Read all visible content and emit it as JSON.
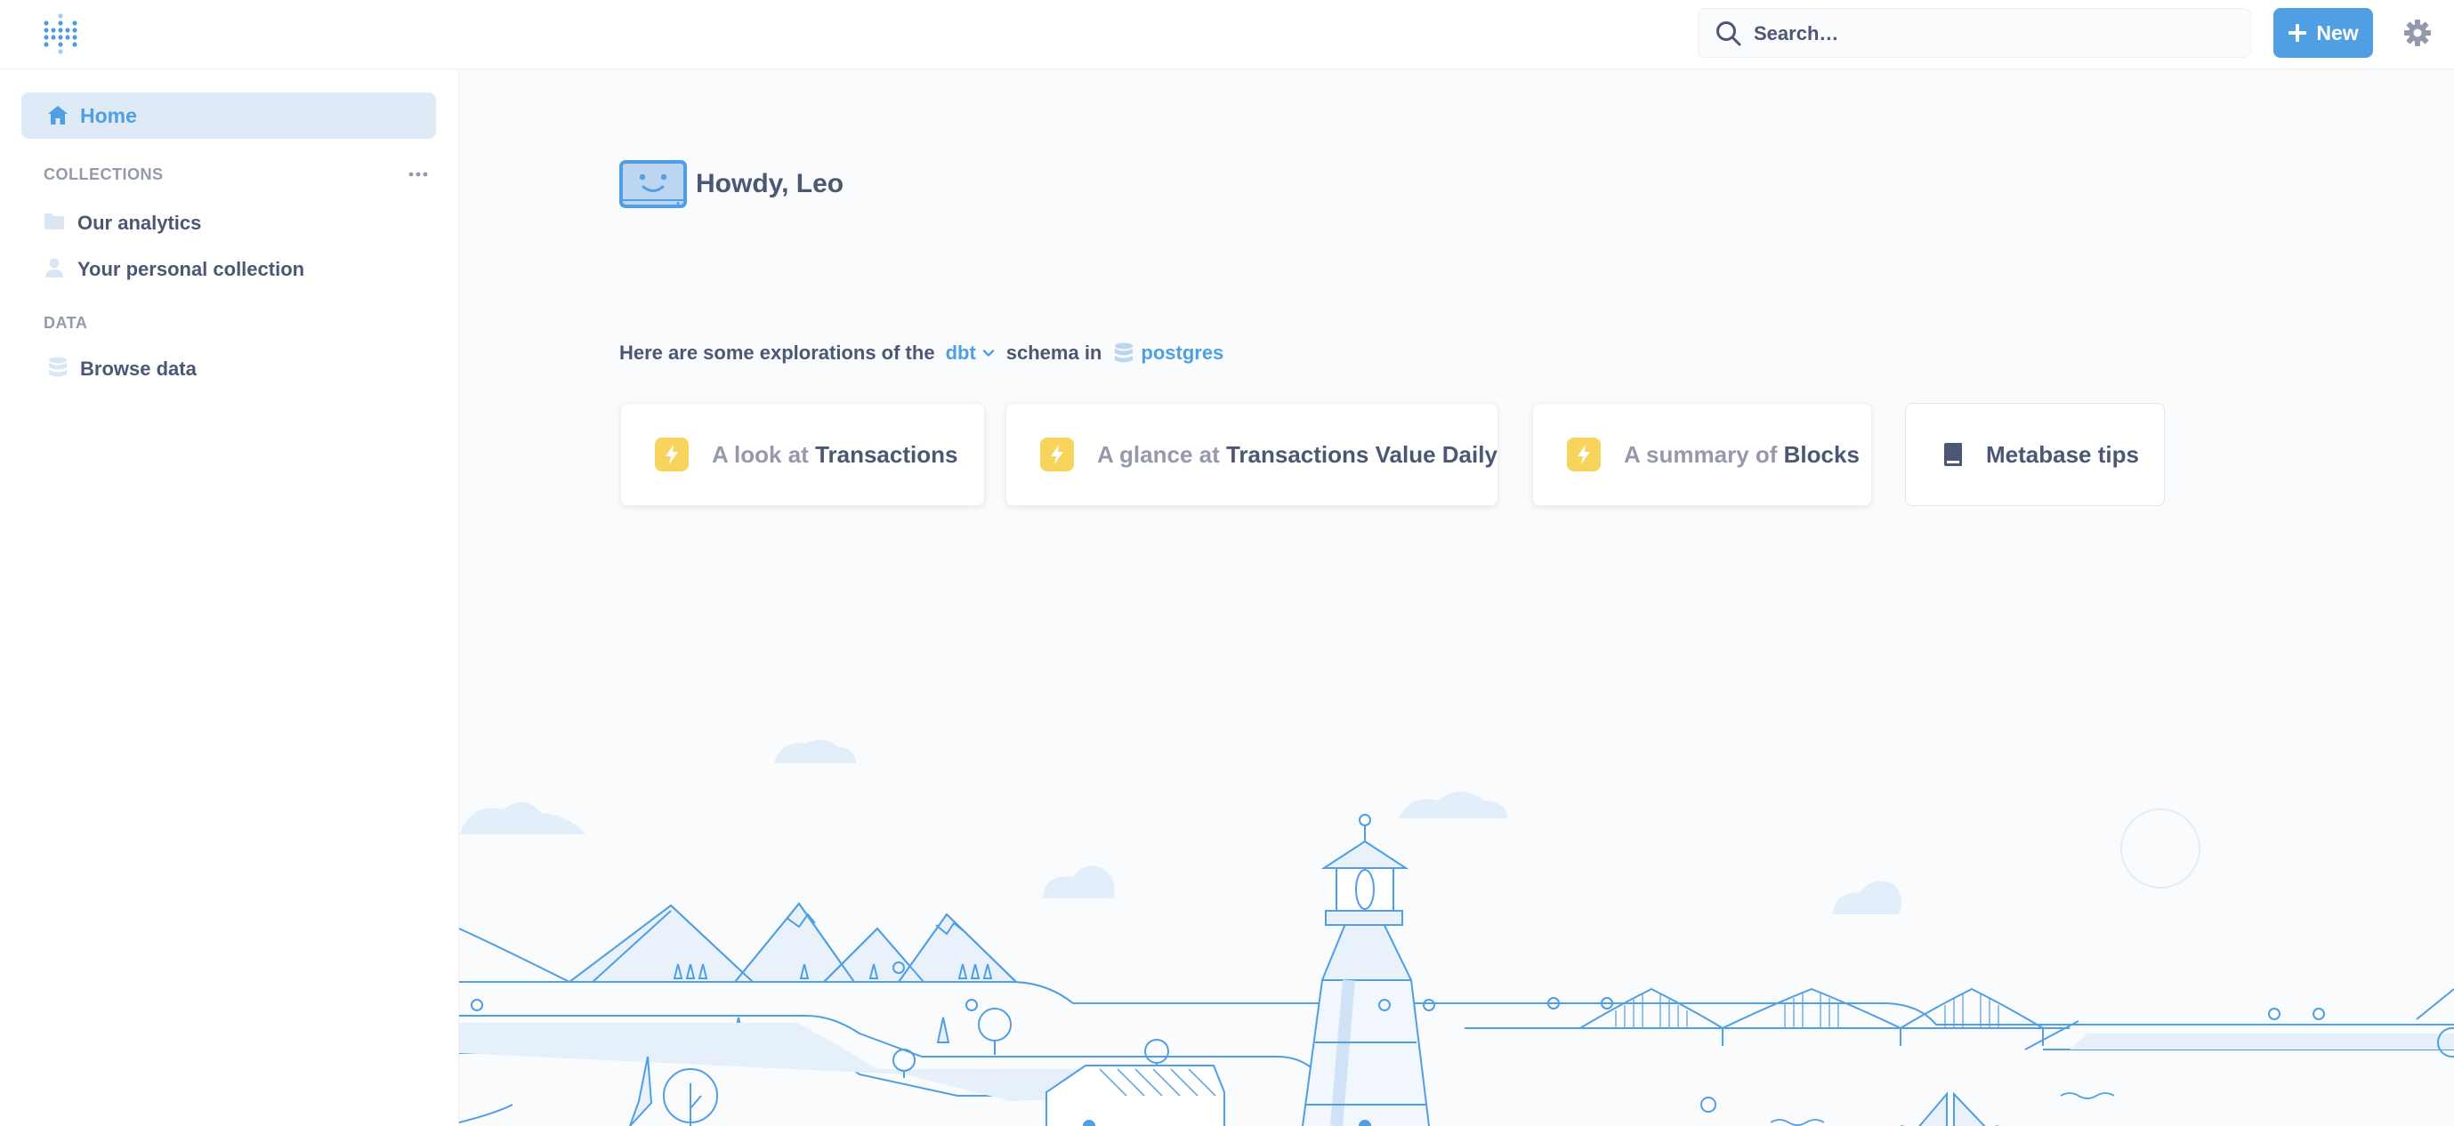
{
  "topbar": {
    "logo_icon": "metabase-logo-icon",
    "search": {
      "placeholder": "Search…"
    },
    "new_button": {
      "label": "New"
    },
    "settings_icon": "gear-icon"
  },
  "sidebar": {
    "home": {
      "label": "Home",
      "icon": "home-icon"
    },
    "collections_title": "COLLECTIONS",
    "collections": [
      {
        "label": "Our analytics",
        "icon": "folder-icon"
      },
      {
        "label": "Your personal collection",
        "icon": "person-icon"
      }
    ],
    "data_title": "DATA",
    "data_items": [
      {
        "label": "Browse data",
        "icon": "database-icon"
      }
    ]
  },
  "main": {
    "greeting": "Howdy, Leo",
    "explore": {
      "prefix": "Here are some explorations of the",
      "schema": "dbt",
      "middle": "schema in",
      "database": "postgres"
    },
    "cards": [
      {
        "prefix": "A look at",
        "entity": "Transactions"
      },
      {
        "prefix": "A glance at",
        "entity": "Transactions Value Daily"
      },
      {
        "prefix": "A summary of",
        "entity": "Blocks"
      }
    ],
    "tips": {
      "label": "Metabase tips"
    }
  },
  "colors": {
    "brand": "#509ee3",
    "text": "#4c5773",
    "muted": "#949aab",
    "bolt": "#f9d45c",
    "highlight": "#deebf7"
  }
}
